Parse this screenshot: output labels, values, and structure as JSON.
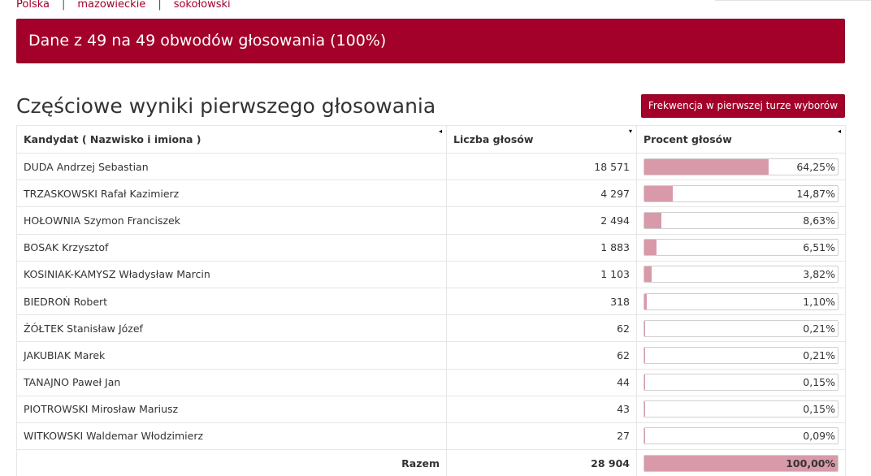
{
  "breadcrumb": {
    "items": [
      "Polska",
      "mazowieckie",
      "sokołowski"
    ],
    "separator": "|"
  },
  "banner": {
    "text": "Dane z 49 na 49 obwodów głosowania (100%)"
  },
  "section": {
    "title": "Częściowe wyniki pierwszego głosowania",
    "turnout_button": "Frekwencja w pierwszej turze wyborów"
  },
  "colors": {
    "accent": "#a3002a",
    "bar_fill": "#d89aa8"
  },
  "table": {
    "headers": {
      "candidate": "Kandydat ( Nazwisko i imiona )",
      "votes": "Liczba głosów",
      "percent": "Procent głosów"
    },
    "sort_icons": {
      "candidate": "◂",
      "votes": "▾",
      "percent": "◂"
    },
    "rows": [
      {
        "name": "DUDA Andrzej Sebastian",
        "votes": "18 571",
        "percent": "64,25%",
        "share": 64.25
      },
      {
        "name": "TRZASKOWSKI Rafał Kazimierz",
        "votes": "4 297",
        "percent": "14,87%",
        "share": 14.87
      },
      {
        "name": "HOŁOWNIA Szymon Franciszek",
        "votes": "2 494",
        "percent": "8,63%",
        "share": 8.63
      },
      {
        "name": "BOSAK Krzysztof",
        "votes": "1 883",
        "percent": "6,51%",
        "share": 6.51
      },
      {
        "name": "KOSINIAK-KAMYSZ Władysław Marcin",
        "votes": "1 103",
        "percent": "3,82%",
        "share": 3.82
      },
      {
        "name": "BIEDROŃ Robert",
        "votes": "318",
        "percent": "1,10%",
        "share": 1.1
      },
      {
        "name": "ŻÓŁTEK Stanisław Józef",
        "votes": "62",
        "percent": "0,21%",
        "share": 0.21
      },
      {
        "name": "JAKUBIAK Marek",
        "votes": "62",
        "percent": "0,21%",
        "share": 0.21
      },
      {
        "name": "TANAJNO Paweł Jan",
        "votes": "44",
        "percent": "0,15%",
        "share": 0.15
      },
      {
        "name": "PIOTROWSKI Mirosław Mariusz",
        "votes": "43",
        "percent": "0,15%",
        "share": 0.15
      },
      {
        "name": "WITKOWSKI Waldemar Włodzimierz",
        "votes": "27",
        "percent": "0,09%",
        "share": 0.09
      }
    ],
    "total": {
      "label": "Razem",
      "votes": "28 904",
      "percent": "100,00%",
      "share": 100
    }
  }
}
